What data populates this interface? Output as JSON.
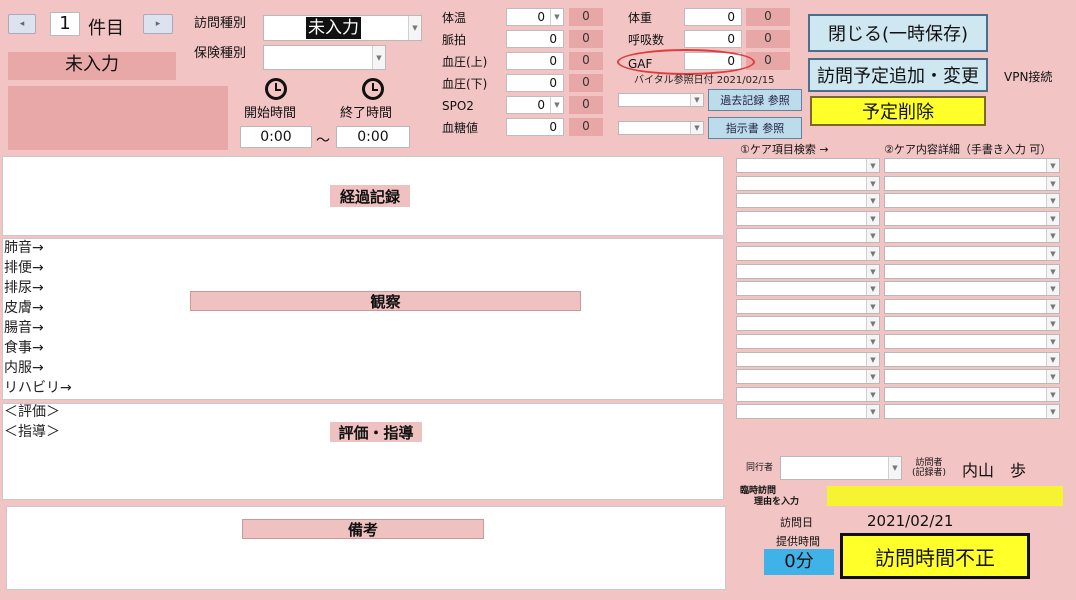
{
  "record_nav": {
    "count": "1",
    "unit": "件目",
    "prev": "◂",
    "next": "▸"
  },
  "status": "未入力",
  "visit_type": {
    "label": "訪問種別",
    "value": "未入力"
  },
  "insurance_type": {
    "label": "保険種別",
    "value": ""
  },
  "time": {
    "start_label": "開始時間",
    "end_label": "終了時間",
    "start": "0:00",
    "end": "0:00",
    "sep": "～"
  },
  "vitals_left": [
    {
      "label": "体温",
      "value": "0",
      "prev": "0",
      "dropdown": true
    },
    {
      "label": "脈拍",
      "value": "0",
      "prev": "0"
    },
    {
      "label": "血圧(上)",
      "value": "0",
      "prev": "0"
    },
    {
      "label": "血圧(下)",
      "value": "0",
      "prev": "0"
    },
    {
      "label": "SPO2",
      "value": "0",
      "prev": "0",
      "dropdown": true
    },
    {
      "label": "血糖値",
      "value": "0",
      "prev": "0"
    }
  ],
  "vitals_right": [
    {
      "label": "体重",
      "value": "0",
      "prev": "0"
    },
    {
      "label": "呼吸数",
      "value": "0",
      "prev": "0"
    },
    {
      "label": "GAF",
      "value": "0",
      "prev": "0"
    }
  ],
  "vital_ref_date": {
    "label": "バイタル参照日付",
    "value": "2021/02/15"
  },
  "buttons": {
    "close": "閉じる(一時保存)",
    "schedule": "訪問予定追加・変更",
    "delete": "予定削除",
    "past_records": "過去記録 参照",
    "instructions": "指示書 参照"
  },
  "vpn": "VPN接続",
  "care_headers": {
    "search": "①ケア項目検索 →",
    "detail": "②ケア内容詳細（手書き入力 可）"
  },
  "sections": {
    "progress": "経過記録",
    "observation": "観察",
    "evaluation": "評価・指導",
    "notes": "備考"
  },
  "observations": [
    "肺音→",
    "排便→",
    "排尿→",
    "皮膚→",
    "腸音→",
    "食事→",
    "内服→",
    "リハビリ→"
  ],
  "eval_lines": [
    "＜評価＞",
    "＜指導＞"
  ],
  "companion": {
    "label": "同行者",
    "value": ""
  },
  "visitor": {
    "label1": "訪問者",
    "label2": "(記録者)",
    "name": "内山　歩"
  },
  "temp_visit": {
    "label1": "臨時訪問",
    "label2": "理由を入力"
  },
  "visit_date": {
    "label": "訪問日",
    "value": "2021/02/21"
  },
  "service_time": {
    "label": "提供時間",
    "value": "0分"
  },
  "warning": "訪問時間不正",
  "colors": {
    "background": "#f2c4c4",
    "accent_blue": "#cfe7f1",
    "warning_yellow": "#ffff2a",
    "highlight_yellow": "#f5f332",
    "service_blue": "#3fb2e8"
  }
}
